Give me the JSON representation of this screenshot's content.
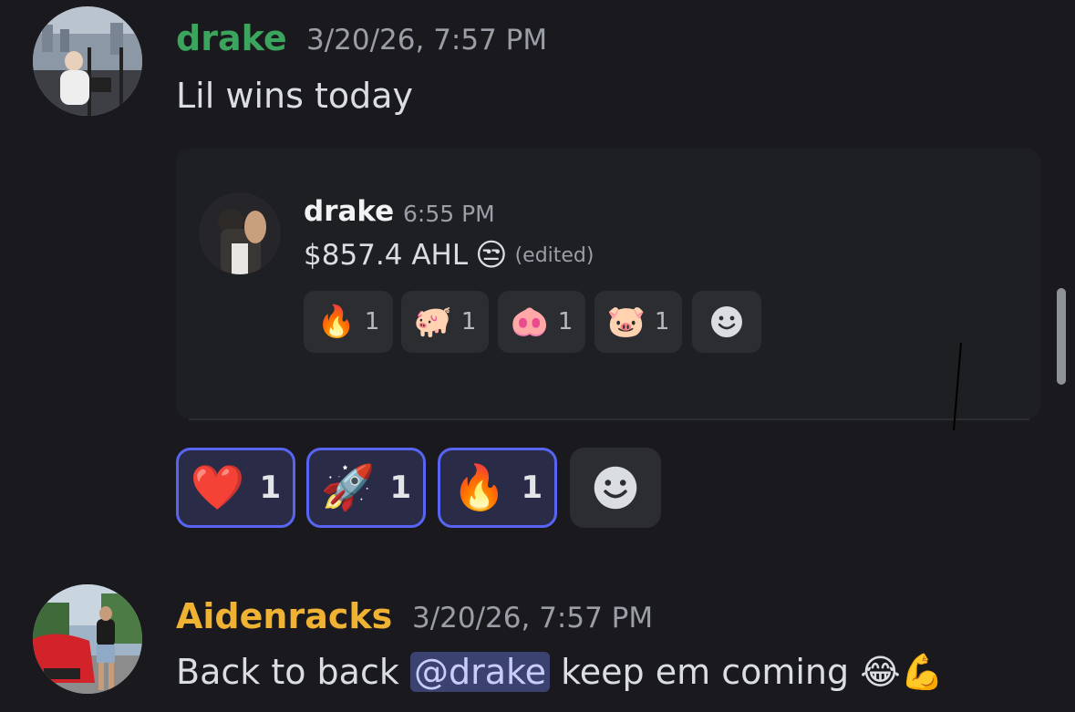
{
  "messages": [
    {
      "username": "drake",
      "username_color": "#3ba55d",
      "timestamp": "3/20/26, 7:57 PM",
      "text": "Lil wins today",
      "forwarded": {
        "username": "drake",
        "timestamp": "6:55 PM",
        "text": "$857.4 AHL",
        "emoji": "😒",
        "edited_label": "(edited)",
        "reactions": [
          {
            "emoji": "🔥",
            "count": "1"
          },
          {
            "emoji": "🐖",
            "count": "1"
          },
          {
            "emoji": "🐽",
            "count": "1"
          },
          {
            "emoji": "🐷",
            "count": "1"
          }
        ]
      },
      "reactions": [
        {
          "emoji": "❤️",
          "count": "1"
        },
        {
          "emoji": "🚀",
          "count": "1"
        },
        {
          "emoji": "🔥",
          "count": "1"
        }
      ]
    },
    {
      "username": "Aidenracks",
      "username_color": "#f0b232",
      "timestamp": "3/20/26, 7:57 PM",
      "text_before": "Back to back",
      "mention": "@drake",
      "text_after": "keep em coming",
      "emojis": "😂💪"
    }
  ],
  "icons": {
    "add_reaction": "smiley-add-reaction-icon"
  },
  "colors": {
    "background": "#1a1a1e",
    "accent": "#5865f2"
  }
}
